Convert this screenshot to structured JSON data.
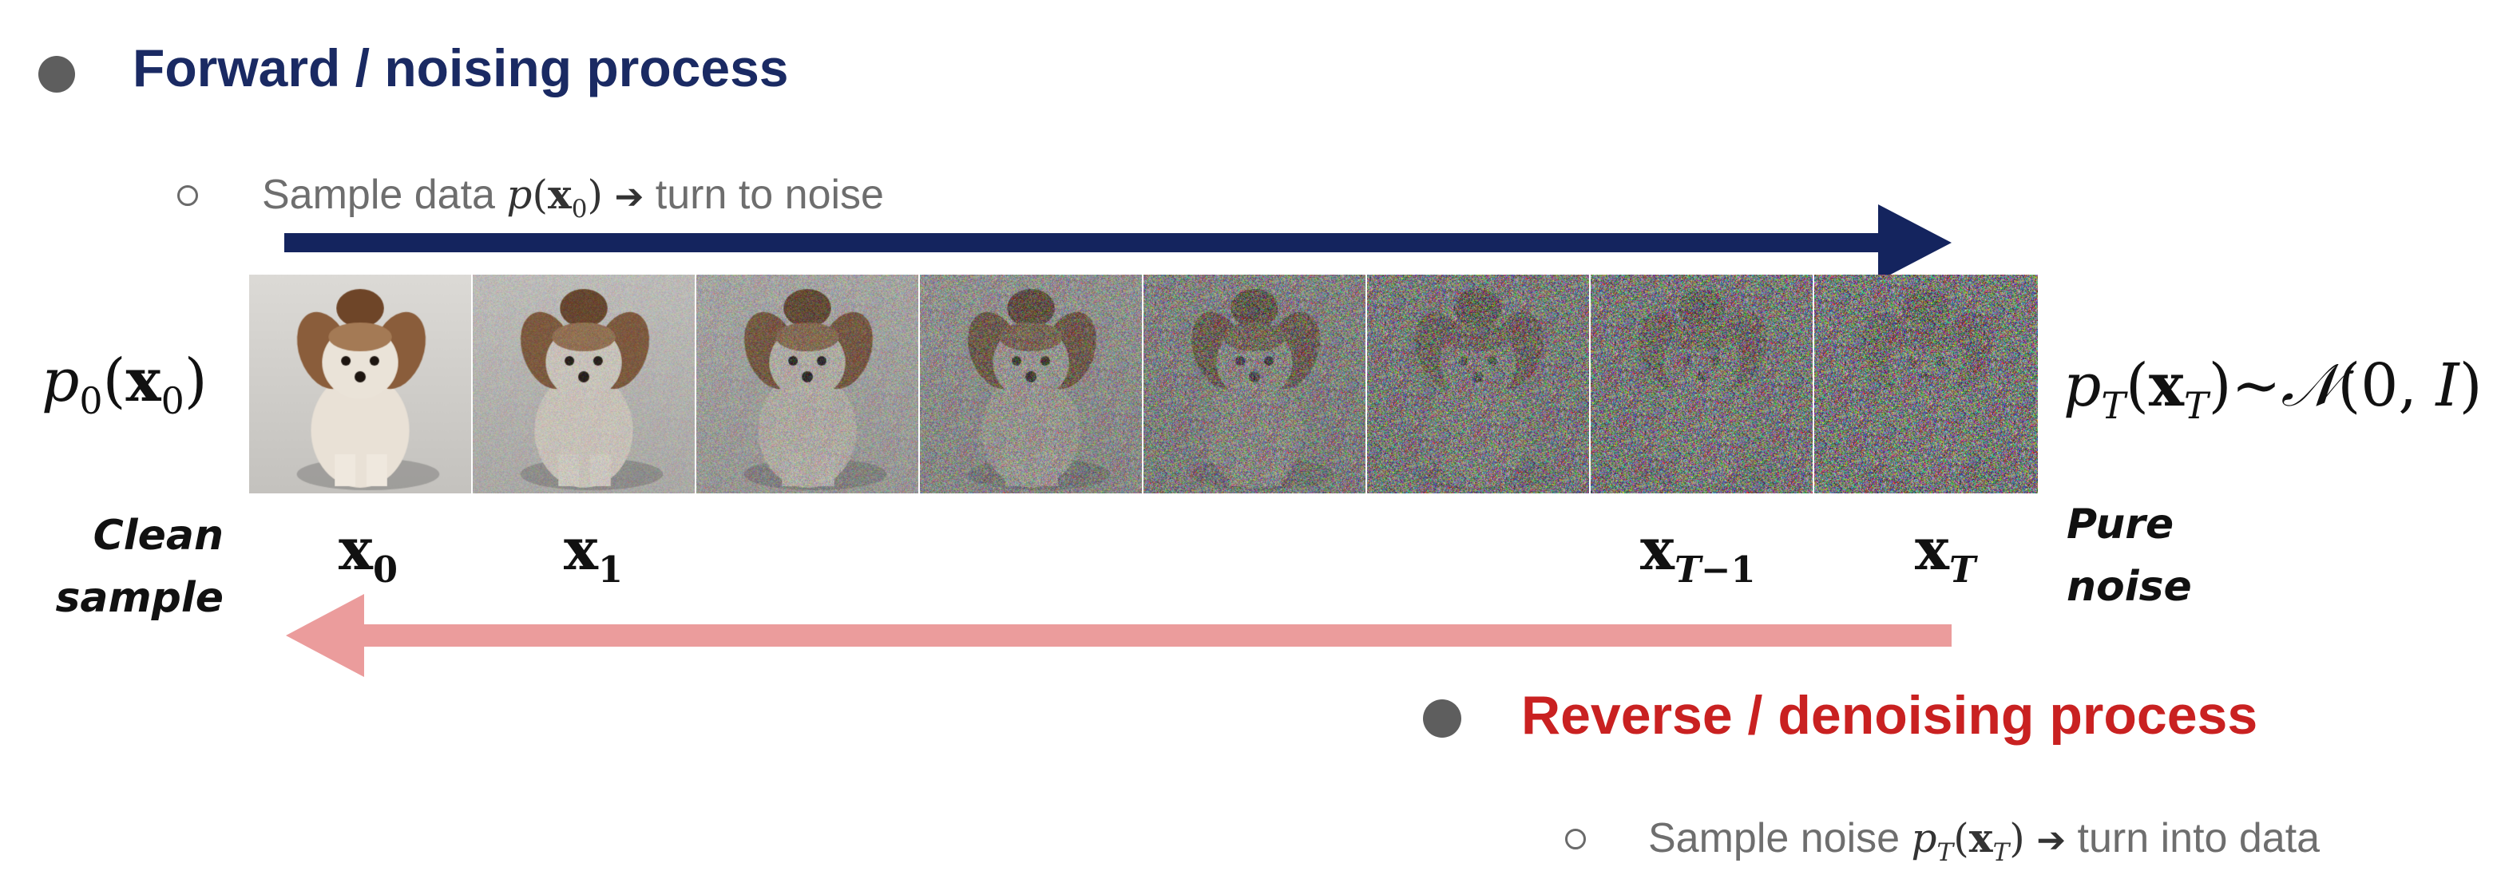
{
  "forward": {
    "heading": "Forward / noising process",
    "sub_prefix": "Sample data ",
    "sub_math": "p(x₀)",
    "sub_arrow": "➔",
    "sub_suffix": " turn to noise",
    "arrow_color": "#14245e"
  },
  "reverse": {
    "heading": "Reverse / denoising process",
    "sub_prefix": "Sample noise ",
    "sub_math": "pₜ(xₜ)",
    "sub_arrow": "➔",
    "sub_suffix": " turn into data",
    "arrow_color": "#eb9c9c"
  },
  "left_formula": "p₀(x₀)",
  "right_formula": "pₜ(xₜ)~𝒩(0,I)",
  "left_caption": [
    "Clean",
    "sample"
  ],
  "right_caption": [
    "Pure",
    "noise"
  ],
  "frame_labels": [
    "x₀",
    "x₁",
    "xₜ₋₁",
    "xₜ"
  ],
  "frames": {
    "count": 8,
    "noise_levels": [
      0.0,
      0.18,
      0.34,
      0.52,
      0.7,
      0.86,
      0.94,
      1.0
    ],
    "subject": "dog-photo"
  },
  "colors": {
    "forward_heading": "#1a2a63",
    "reverse_heading": "#c92121",
    "bullet": "#5e5e5e",
    "subtext": "#6e6e6e"
  }
}
